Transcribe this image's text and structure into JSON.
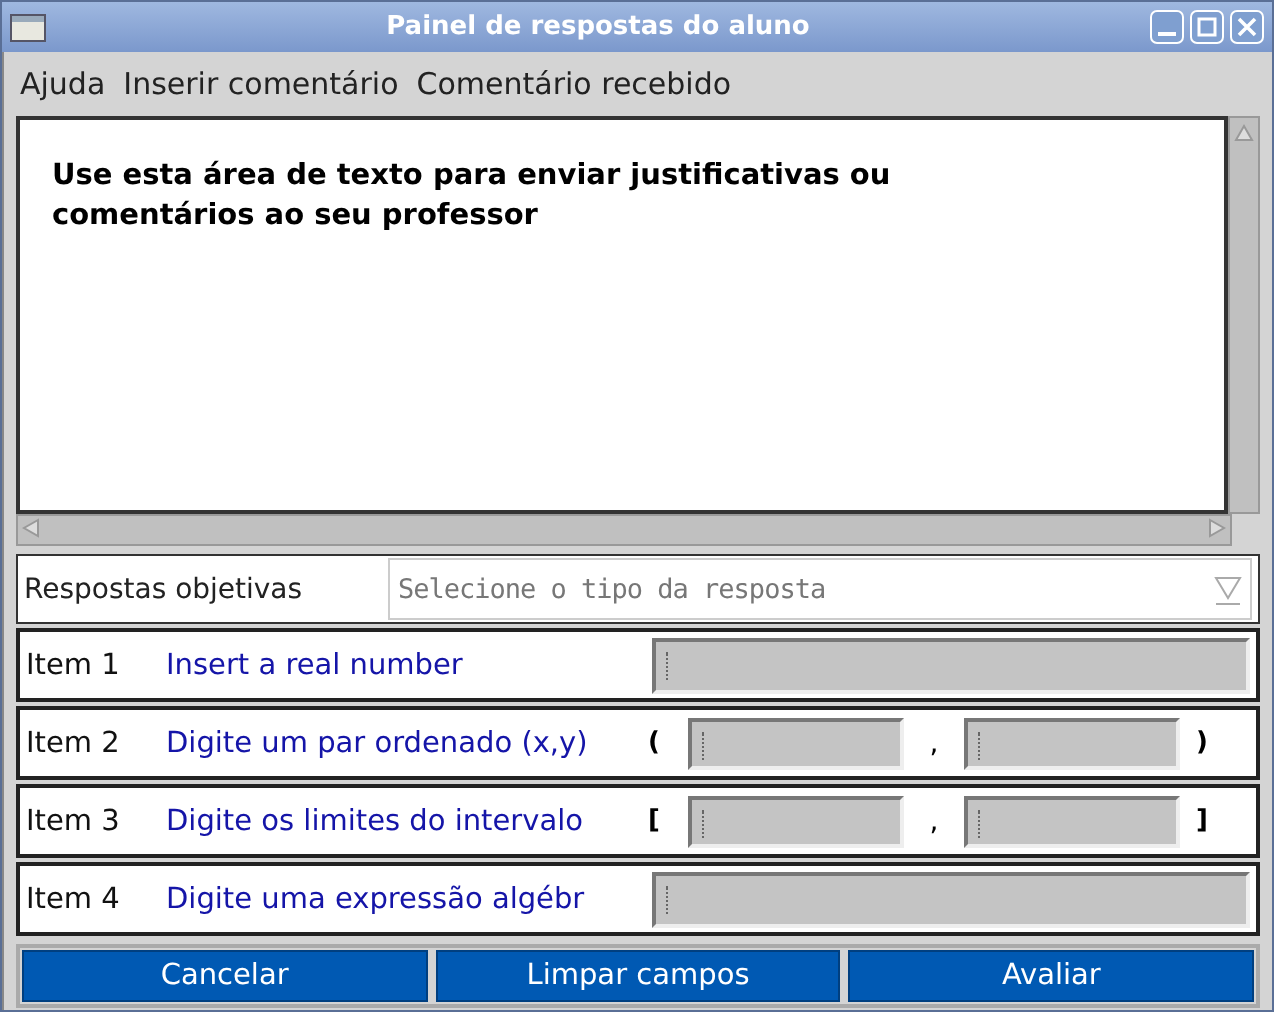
{
  "window": {
    "title": "Painel de respostas do aluno"
  },
  "menu": [
    "Ajuda",
    "Inserir comentário",
    "Comentário recebido"
  ],
  "comment_area": {
    "value": "Use esta área de texto para enviar justificativas ou comentários ao seu professor"
  },
  "answer_type": {
    "label": "Respostas objetivas",
    "placeholder": "Selecione o tipo da resposta"
  },
  "items": [
    {
      "kind": "single",
      "number": "Item 1",
      "prompt": "Insert a real number"
    },
    {
      "kind": "pair",
      "number": "Item 2",
      "prompt": "Digite um par ordenado (x,y)",
      "open": "(",
      "separator": ",",
      "close": ")"
    },
    {
      "kind": "pair",
      "number": "Item 3",
      "prompt": "Digite os limites do intervalo",
      "open": "[",
      "separator": ",",
      "close": "]"
    },
    {
      "kind": "single",
      "number": "Item 4",
      "prompt": "Digite uma expressão algébr"
    }
  ],
  "buttons": [
    "Cancelar",
    "Limpar campos",
    "Avaliar"
  ]
}
